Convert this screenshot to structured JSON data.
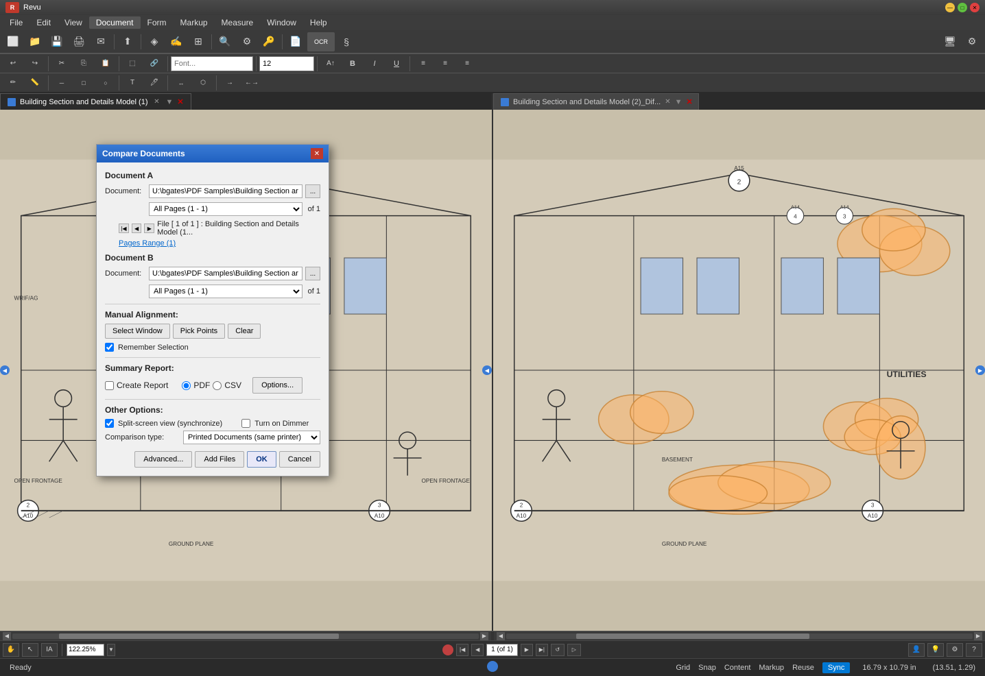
{
  "app": {
    "title": "Revu",
    "logo": "R"
  },
  "titlebar": {
    "minimize": "—",
    "maximize": "□",
    "close": "✕"
  },
  "menubar": {
    "items": [
      "File",
      "Edit",
      "View",
      "Document",
      "Form",
      "Markup",
      "Measure",
      "Window",
      "Help"
    ]
  },
  "toolbar1": {
    "buttons": [
      "⬛",
      "📂",
      "💾",
      "🖨",
      "✉",
      "📎",
      "🔍",
      "⚙",
      "🔑",
      "📄",
      "📊",
      "§"
    ]
  },
  "toolbar2": {
    "font_size": "12",
    "bold": "B",
    "italic": "I",
    "underline": "U"
  },
  "document_tabs": {
    "left": {
      "label": "Building Section and Details Model (1)",
      "active": true
    },
    "right": {
      "label": "Building Section and Details Model (2)_Dif...",
      "active": false
    }
  },
  "dialog": {
    "title": "Compare Documents",
    "document_a_label": "Document A",
    "document_a_doc_label": "Document:",
    "document_a_path": "U:\\bgates\\PDF Samples\\Building Section ar",
    "document_a_pages": "All Pages (1 - 1)",
    "document_a_of": "of  1",
    "document_a_file_info": "File [ 1 of 1 ] :  Building Section and Details Model (1...",
    "document_a_pages_range": "Pages Range (1)",
    "document_b_label": "Document B",
    "document_b_doc_label": "Document:",
    "document_b_path": "U:\\bgates\\PDF Samples\\Building Section ar",
    "document_b_pages": "All Pages (1 - 1)",
    "document_b_of": "of  1",
    "manual_alignment_label": "Manual Alignment:",
    "select_window_btn": "Select Window",
    "pick_points_btn": "Pick Points",
    "clear_btn": "Clear",
    "remember_selection_label": "Remember Selection",
    "summary_report_label": "Summary Report:",
    "create_report_label": "Create Report",
    "pdf_label": "PDF",
    "csv_label": "CSV",
    "options_btn": "Options...",
    "other_options_label": "Other Options:",
    "split_screen_label": "Split-screen view (synchronize)",
    "turn_on_dimmer_label": "Turn on Dimmer",
    "comparison_type_label": "Comparison type:",
    "comparison_type_value": "Printed Documents (same printer)",
    "advanced_btn": "Advanced...",
    "add_files_btn": "Add Files",
    "ok_btn": "OK",
    "cancel_btn": "Cancel"
  },
  "statusbar": {
    "ready": "Ready",
    "grid": "Grid",
    "snap": "Snap",
    "content": "Content",
    "markup": "Markup",
    "reuse": "Reuse",
    "sync": "Sync",
    "dimensions": "16.79 x 10.79 in",
    "coordinates": "(13.51, 1.29)"
  },
  "nav_toolbar": {
    "page_info": "1 (of 1)",
    "zoom": "122.25%"
  },
  "panel_arrow_left": "◀",
  "panel_arrow_right": "▶"
}
